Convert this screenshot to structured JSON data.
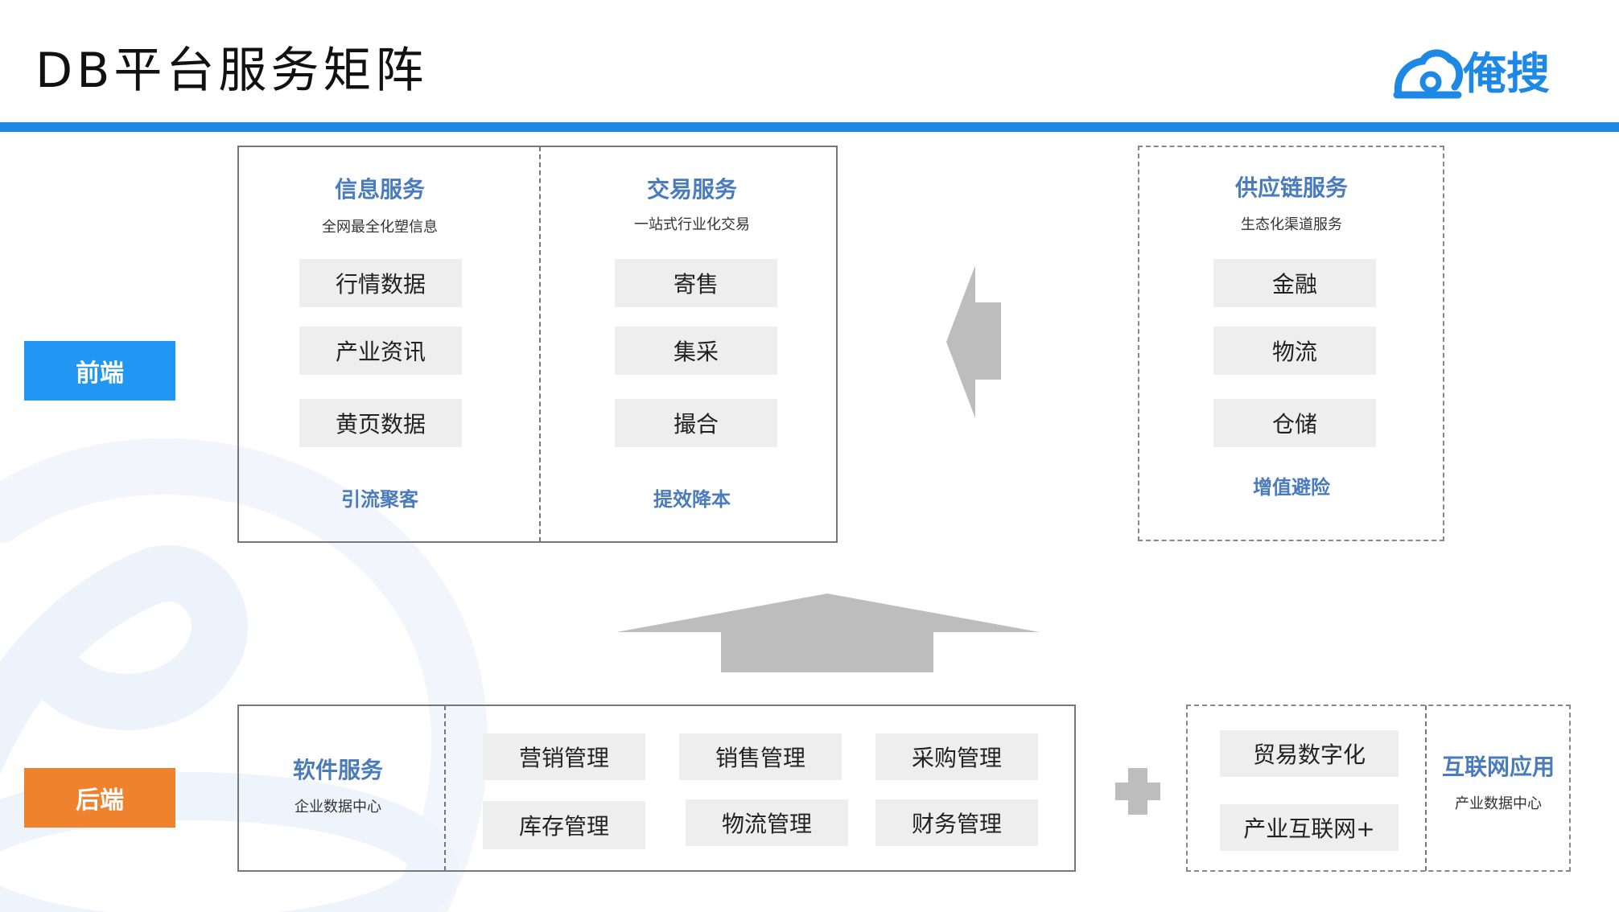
{
  "header": {
    "title": "DB平台服务矩阵",
    "logo_text": "俺搜"
  },
  "labels": {
    "front": "前端",
    "back": "后端"
  },
  "info_service": {
    "title": "信息服务",
    "subtitle": "全网最全化塑信息",
    "items": [
      "行情数据",
      "产业资讯",
      "黄页数据"
    ],
    "footer": "引流聚客"
  },
  "trade_service": {
    "title": "交易服务",
    "subtitle": "一站式行业化交易",
    "items": [
      "寄售",
      "集采",
      "撮合"
    ],
    "footer": "提效降本"
  },
  "supply_service": {
    "title": "供应链服务",
    "subtitle": "生态化渠道服务",
    "items": [
      "金融",
      "物流",
      "仓储"
    ],
    "footer": "增值避险"
  },
  "software_service": {
    "title": "软件服务",
    "subtitle": "企业数据中心",
    "items": [
      "营销管理",
      "销售管理",
      "采购管理",
      "库存管理",
      "物流管理",
      "财务管理"
    ]
  },
  "internet_app": {
    "items": [
      "贸易数字化",
      "产业互联网+"
    ],
    "title": "互联网应用",
    "subtitle": "产业数据中心"
  },
  "colors": {
    "accent_blue": "#1e88e5",
    "front_label": "#2196f3",
    "back_label": "#f0822d",
    "section_title": "#4a7bbd",
    "chip_bg": "#eeeeee",
    "arrow_gray": "#bdbdbd"
  }
}
